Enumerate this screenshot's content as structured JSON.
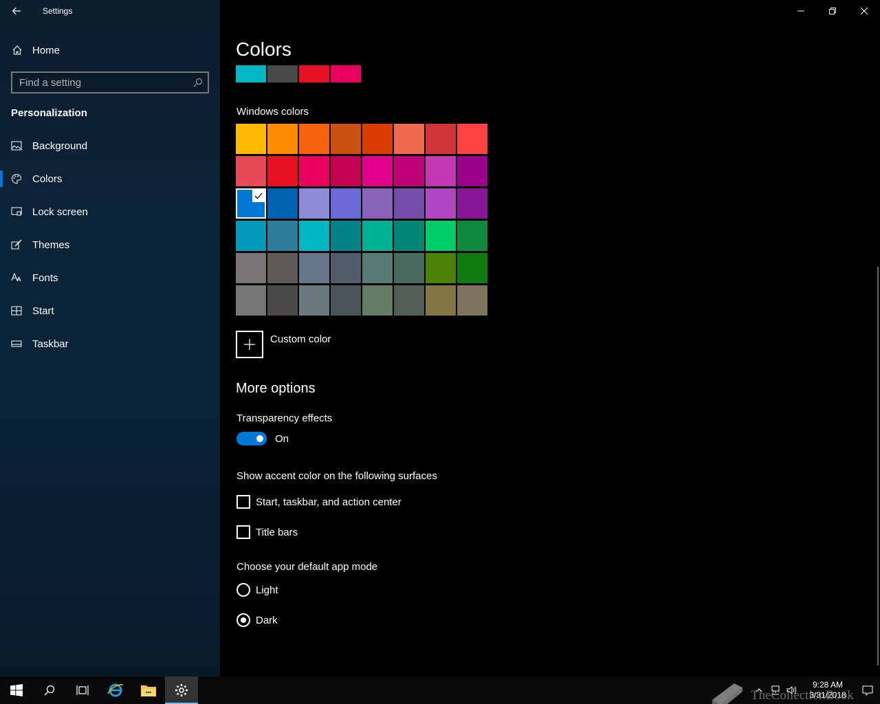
{
  "app": {
    "title": "Settings"
  },
  "sidebar": {
    "home_label": "Home",
    "search_placeholder": "Find a setting",
    "section": "Personalization",
    "items": [
      {
        "label": "Background",
        "icon": "picture-icon"
      },
      {
        "label": "Colors",
        "icon": "palette-icon",
        "active": true
      },
      {
        "label": "Lock screen",
        "icon": "lock-screen-icon"
      },
      {
        "label": "Themes",
        "icon": "brush-icon"
      },
      {
        "label": "Fonts",
        "icon": "font-icon"
      },
      {
        "label": "Start",
        "icon": "start-tiles-icon"
      },
      {
        "label": "Taskbar",
        "icon": "taskbar-icon"
      }
    ]
  },
  "main": {
    "title": "Colors",
    "recent_colors": [
      "#00b7c3",
      "#4c4a48",
      "#e81123",
      "#ea005e"
    ],
    "windows_colors_label": "Windows colors",
    "windows_colors": [
      [
        "#ffb900",
        "#ff8c00",
        "#f7630c",
        "#ca5010",
        "#da3b01",
        "#ef6950",
        "#d13438",
        "#ff4343"
      ],
      [
        "#e74856",
        "#e81123",
        "#ea005e",
        "#c30052",
        "#e3008c",
        "#bf0077",
        "#c239b3",
        "#9a0089"
      ],
      [
        "#0078d7",
        "#0063b1",
        "#8e8cd8",
        "#6b69d6",
        "#8764b8",
        "#744da9",
        "#b146c2",
        "#881798"
      ],
      [
        "#0099bc",
        "#2d7d9a",
        "#00b7c3",
        "#038387",
        "#00b294",
        "#018574",
        "#00cc6a",
        "#10893e"
      ],
      [
        "#7a7574",
        "#5d5a58",
        "#68768a",
        "#515c6b",
        "#567c73",
        "#486860",
        "#498205",
        "#107c10"
      ],
      [
        "#767676",
        "#4c4a48",
        "#69797e",
        "#4a5459",
        "#647c64",
        "#525e54",
        "#847545",
        "#7e735f"
      ]
    ],
    "selected_color": "#0078d7",
    "custom_color_label": "Custom color",
    "more_options": "More options",
    "transparency_label": "Transparency effects",
    "transparency_state": "On",
    "accent_surfaces_label": "Show accent color on the following surfaces",
    "checkbox_start": "Start, taskbar, and action center",
    "checkbox_titlebars": "Title bars",
    "app_mode_label": "Choose your default app mode",
    "mode_light": "Light",
    "mode_dark": "Dark",
    "mode_selected": "Dark",
    "accent": "#0078d7"
  },
  "taskbar": {
    "time": "9:28 AM",
    "date": "3/31/2018",
    "watermark": "TheCollectionBook"
  }
}
